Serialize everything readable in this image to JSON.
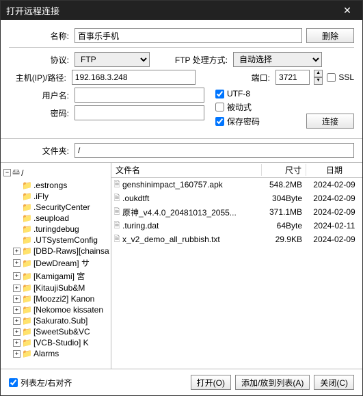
{
  "title": "打开远程连接",
  "form": {
    "name_label": "名称:",
    "name_value": "百事乐手机",
    "delete_btn": "删除",
    "protocol_label": "协议:",
    "protocol_value": "FTP",
    "ftp_mode_label": "FTP 处理方式:",
    "ftp_mode_value": "自动选择",
    "host_label": "主机(IP)/路径:",
    "host_value": "192.168.3.248",
    "port_label": "端口:",
    "port_value": "3721",
    "ssl_label": "SSL",
    "user_label": "用户名:",
    "user_value": "",
    "pass_label": "密码:",
    "pass_value": "",
    "utf8_label": "UTF-8",
    "passive_label": "被动式",
    "savepass_label": "保存密码",
    "connect_btn": "连接",
    "folder_label": "文件夹:",
    "folder_value": "/"
  },
  "tree": {
    "root": "/",
    "items": [
      ".estrongs",
      ".iFly",
      ".SecurityCenter",
      ".seupload",
      ".turingdebug",
      ".UTSystemConfig",
      "[DBD-Raws][chainsaw",
      "[DewDream] サ",
      "[Kamigami] 宮",
      "[KitaujiSub&M",
      "[Moozzi2] Kanon",
      "[Nekomoe kissaten",
      "[Sakurato.Sub]",
      "[SweetSub&VC",
      "[VCB-Studio] K",
      "Alarms"
    ]
  },
  "filelist": {
    "header_name": "文件名",
    "header_size": "尺寸",
    "header_date": "日期",
    "rows": [
      {
        "name": "genshinimpact_160757.apk",
        "size": "548.2MB",
        "date": "2024-02-09"
      },
      {
        "name": ".oukdtft",
        "size": "304Byte",
        "date": "2024-02-09"
      },
      {
        "name": "原神_v4.4.0_20481013_2055...",
        "size": "371.1MB",
        "date": "2024-02-09"
      },
      {
        "name": ".turing.dat",
        "size": "64Byte",
        "date": "2024-02-11"
      },
      {
        "name": "x_v2_demo_all_rubbish.txt",
        "size": "29.9KB",
        "date": "2024-02-09"
      }
    ]
  },
  "bottom": {
    "align_label": "列表左/右对齐",
    "open_btn": "打开(O)",
    "add_btn": "添加/放到列表(A)",
    "close_btn": "关闭(C)"
  }
}
